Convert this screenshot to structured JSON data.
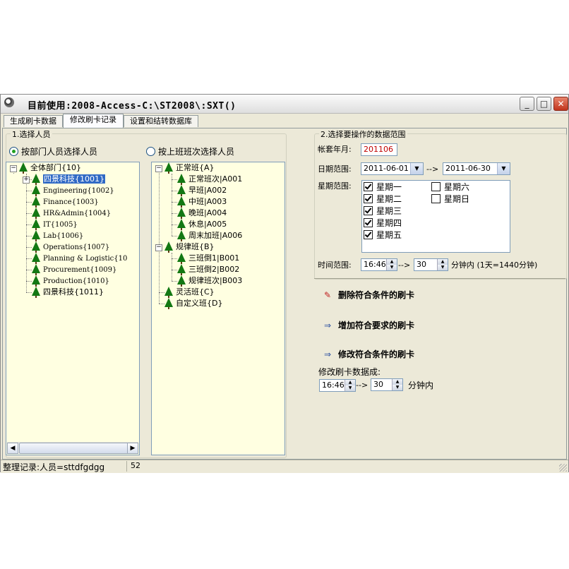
{
  "window": {
    "title": "目前使用:2008-Access-C:\\ST2008\\:SXT()",
    "min_label": "_",
    "max_label": "□",
    "close_label": "✕"
  },
  "tabs": [
    "生成刷卡数据",
    "修改刷卡记录",
    "设置和结转数据库"
  ],
  "active_tab": 1,
  "select_people": {
    "group_label": "1.选择人员",
    "radio_dept": "按部门人员选择人员",
    "radio_shift": "按上班班次选择人员",
    "dept_tree": {
      "root": "全体部门{10}",
      "items": [
        "四景科技{1001}",
        "Engineering{1002}",
        "Finance{1003}",
        "HR&Admin{1004}",
        "IT{1005}",
        "Lab{1006}",
        "Operations{1007}",
        "Planning & Logistic{10",
        "Procurement{1009}",
        "Production{1010}",
        "四景科技{1011}"
      ]
    },
    "shift_tree": {
      "groups": [
        {
          "label": "正常班{A}",
          "items": [
            "正常班次|A001",
            "早班|A002",
            "中班|A003",
            "晚班|A004",
            "休息|A005",
            "周末加班|A006"
          ]
        },
        {
          "label": "规律班{B}",
          "items": [
            "三班倒1|B001",
            "三班倒2|B002",
            "规律班次|B003"
          ]
        },
        {
          "label": "灵活班{C}",
          "items": []
        },
        {
          "label": "自定义班{D}",
          "items": []
        }
      ]
    }
  },
  "range": {
    "group_label": "2.选择要操作的数据范围",
    "account_label": "帐套年月:",
    "account_value": "201106",
    "date_label": "日期范围:",
    "date_from": "2011-06-01",
    "date_arrow": "-->",
    "date_to": "2011-06-30",
    "week_label": "星期范围:",
    "weekdays": [
      {
        "label": "星期一",
        "checked": true
      },
      {
        "label": "星期二",
        "checked": true
      },
      {
        "label": "星期三",
        "checked": true
      },
      {
        "label": "星期四",
        "checked": true
      },
      {
        "label": "星期五",
        "checked": true
      },
      {
        "label": "星期六",
        "checked": false
      },
      {
        "label": "星期日",
        "checked": false
      }
    ],
    "time_label": "时间范围:",
    "time_from": "16:46",
    "time_arrow": "-->",
    "time_minutes": "30",
    "time_suffix": "分钟内 (1天=1440分钟)"
  },
  "actions": {
    "delete_label": "删除符合条件的刷卡",
    "add_label": "增加符合要求的刷卡",
    "modify_label": "修改符合条件的刷卡",
    "modify_to_label": "修改刷卡数据成:",
    "modify_time": "16:46",
    "modify_arrow": "-->",
    "modify_minutes": "30",
    "modify_suffix": "分钟内"
  },
  "status": {
    "text": "整理记录:人员=sttdfgdgg",
    "count": "52"
  }
}
